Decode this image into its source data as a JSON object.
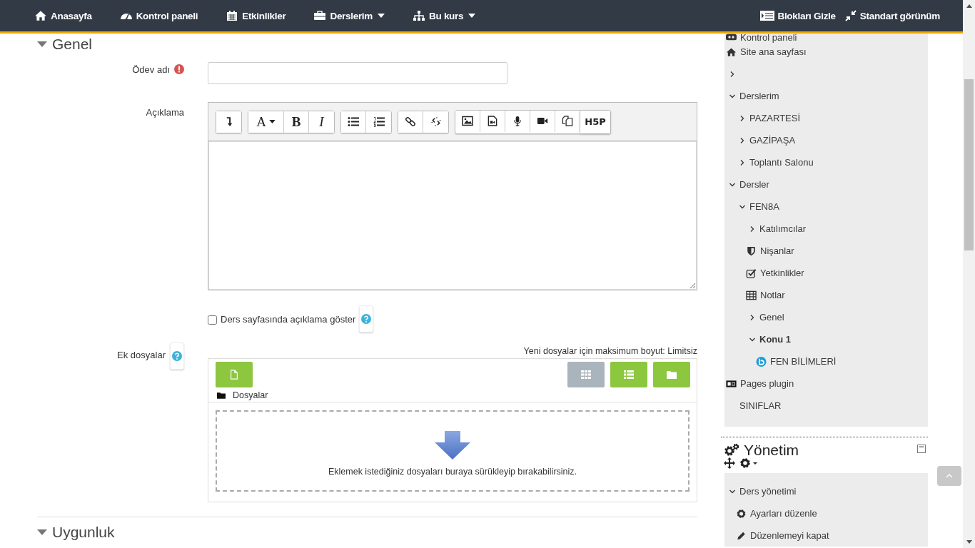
{
  "navbar": {
    "items": [
      {
        "label": "Anasayfa",
        "kind": "home",
        "has_menu": false
      },
      {
        "label": "Kontrol paneli",
        "kind": "dashboard",
        "has_menu": false
      },
      {
        "label": "Etkinlikler",
        "kind": "calendar",
        "has_menu": false
      },
      {
        "label": "Derslerim",
        "kind": "briefcase",
        "has_menu": true
      },
      {
        "label": "Bu kurs",
        "kind": "sitemap",
        "has_menu": true
      }
    ],
    "right_items": [
      {
        "label": "Blokları Gizle",
        "kind": "blocks"
      },
      {
        "label": "Standart görünüm",
        "kind": "compress"
      }
    ]
  },
  "form": {
    "sections": [
      {
        "title": "Genel",
        "expanded": true,
        "fields": [
          {
            "kind": "text",
            "label": "Ödev adı",
            "required": true
          },
          {
            "kind": "editor",
            "label": "Açıklama",
            "toolbar": [
              [
                {
                  "kind": "collapse"
                }
              ],
              [
                {
                  "kind": "font",
                  "label": "A",
                  "caret": true
                },
                {
                  "kind": "bold",
                  "label": "B"
                },
                {
                  "kind": "italic",
                  "label": "I"
                }
              ],
              [
                {
                  "kind": "bullets"
                },
                {
                  "kind": "numbers"
                }
              ],
              [
                {
                  "kind": "link"
                },
                {
                  "kind": "unlink"
                }
              ],
              [
                {
                  "kind": "image"
                },
                {
                  "kind": "media"
                },
                {
                  "kind": "mic"
                },
                {
                  "kind": "video"
                },
                {
                  "kind": "copy"
                },
                {
                  "kind": "logo",
                  "label": "H5P"
                }
              ]
            ]
          },
          {
            "kind": "checkbox",
            "label": "Ders sayfasında açıklama göster",
            "checked": false,
            "help": true
          },
          {
            "kind": "files",
            "label": "Ek dosyalar",
            "help": true,
            "max_size": "Yeni dosyalar için maksimum boyut: Limitsiz",
            "path": "Dosyalar",
            "drop_text": "Eklemek istediğiniz dosyaları buraya sürükleyip bırakabilirsiniz.",
            "views": [
              {
                "kind": "grid",
                "selected": true
              },
              {
                "kind": "list",
                "selected": false
              },
              {
                "kind": "folder",
                "selected": false
              }
            ]
          }
        ]
      },
      {
        "title": "Uygunluk",
        "expanded": true
      }
    ]
  },
  "navigation": {
    "items": [
      {
        "label": "Kontrol paneli",
        "kind": "dashboard"
      },
      {
        "label": "Site ana sayfası",
        "kind": "home"
      },
      {
        "kind": "branch",
        "expanded": false
      },
      {
        "label": "Derslerim",
        "kind": "branch",
        "expanded": true,
        "children": [
          {
            "label": "PAZARTESİ",
            "kind": "branch",
            "expanded": false
          },
          {
            "label": "GAZİPAŞA",
            "kind": "branch",
            "expanded": false
          },
          {
            "label": "Toplantı Salonu",
            "kind": "branch",
            "expanded": false
          }
        ]
      },
      {
        "label": "Dersler",
        "kind": "branch",
        "expanded": true,
        "children": [
          {
            "label": "FEN8A",
            "kind": "branch",
            "expanded": true,
            "children": [
              {
                "label": "Katılımcılar",
                "kind": "branch",
                "expanded": false
              },
              {
                "label": "Nişanlar",
                "kind": "badge"
              },
              {
                "label": "Yetkinlikler",
                "kind": "competency"
              },
              {
                "label": "Notlar",
                "kind": "grades"
              },
              {
                "label": "Genel",
                "kind": "branch",
                "expanded": false
              },
              {
                "label": "Konu 1",
                "kind": "branch",
                "expanded": true,
                "current": true,
                "children": [
                  {
                    "label": "FEN BİLİMLERİ",
                    "kind": "conference"
                  }
                ]
              }
            ]
          }
        ]
      },
      {
        "label": "Pages plugin",
        "kind": "pages"
      },
      {
        "label": "SINIFLAR",
        "kind": "plain"
      }
    ]
  },
  "administration": {
    "title": "Yönetim",
    "items": [
      {
        "label": "Ders yönetimi",
        "kind": "branch",
        "expanded": true,
        "children": [
          {
            "label": "Ayarları düzenle",
            "kind": "gear"
          },
          {
            "label": "Düzenlemeyi kapat",
            "kind": "pencil"
          }
        ]
      }
    ]
  }
}
